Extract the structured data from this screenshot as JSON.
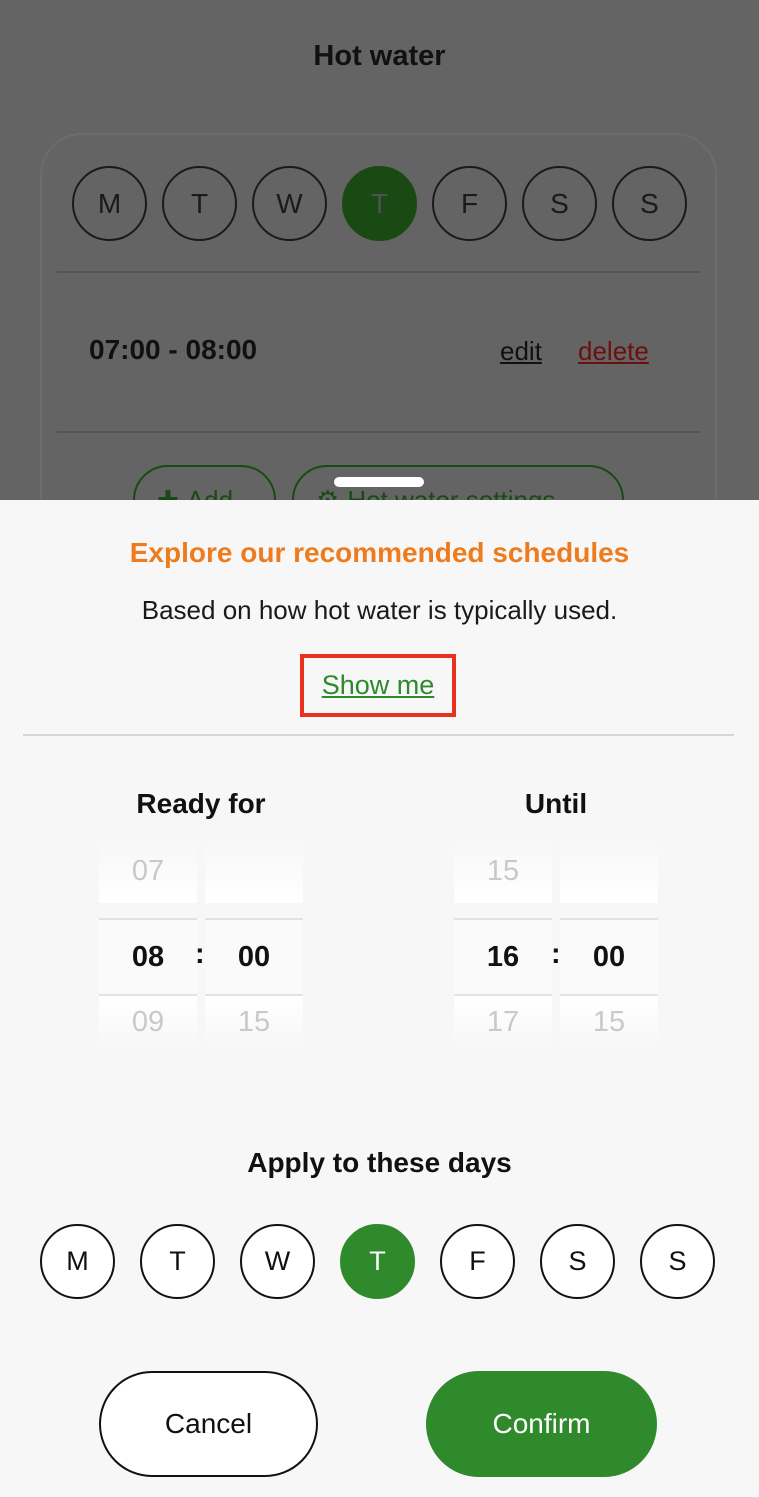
{
  "background": {
    "title": "Hot water",
    "days": [
      "M",
      "T",
      "W",
      "T",
      "F",
      "S",
      "S"
    ],
    "active_day_index": 3,
    "slot": {
      "time": "07:00 - 08:00",
      "edit": "edit",
      "delete": "delete"
    },
    "add_label": "Add",
    "settings_label": "Hot water settings"
  },
  "sheet": {
    "explore_title": "Explore our recommended schedules",
    "explore_subtitle": "Based on how hot water is typically used.",
    "show_me": "Show me",
    "ready_for": {
      "title": "Ready for",
      "hour": {
        "prev": "07",
        "current": "08",
        "next": "09"
      },
      "minute": {
        "prev": "",
        "current": "00",
        "next": "15"
      }
    },
    "until": {
      "title": "Until",
      "hour": {
        "prev": "15",
        "current": "16",
        "next": "17"
      },
      "minute": {
        "prev": "",
        "current": "00",
        "next": "15"
      }
    },
    "separator": ":",
    "apply_title": "Apply to these days",
    "days": [
      "M",
      "T",
      "W",
      "T",
      "F",
      "S",
      "S"
    ],
    "active_day_index": 3,
    "cancel": "Cancel",
    "confirm": "Confirm"
  },
  "colors": {
    "accent_green": "#2f8a2c",
    "orange": "#ee7c1e",
    "highlight_red": "#e8321e"
  }
}
